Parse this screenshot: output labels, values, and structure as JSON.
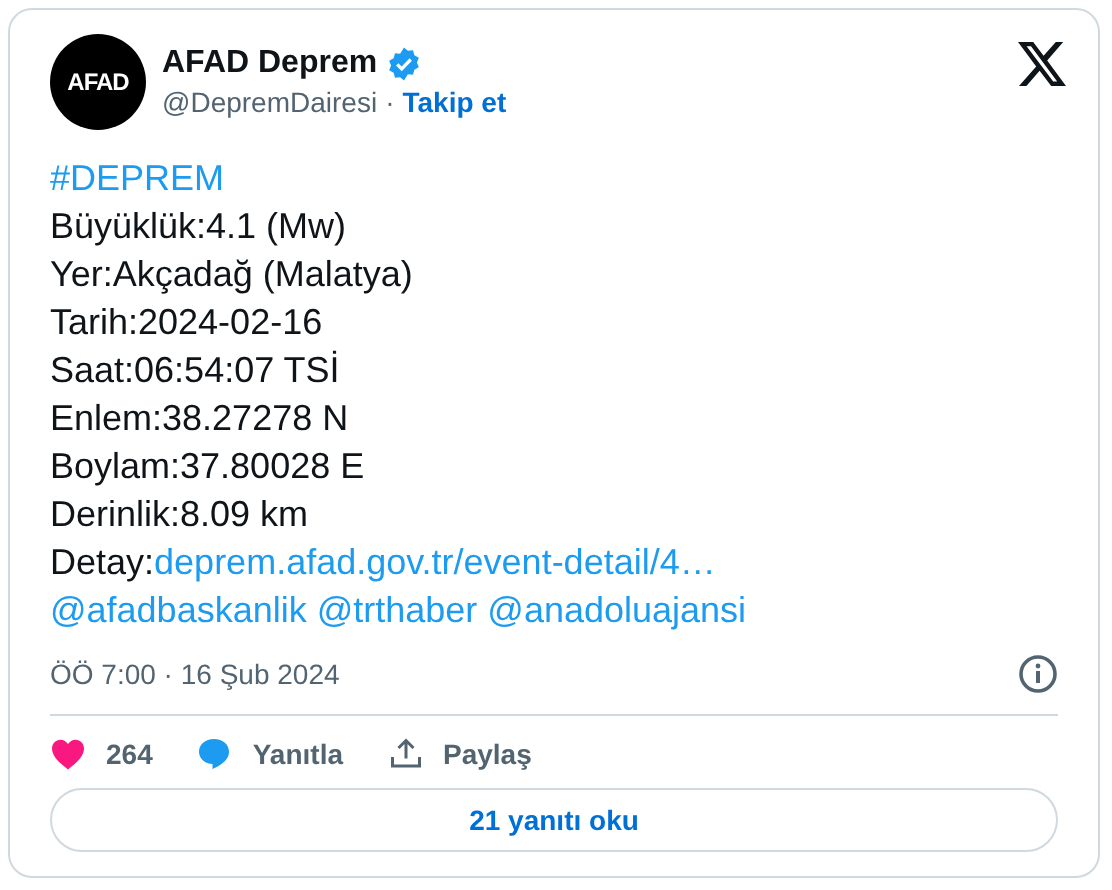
{
  "author": {
    "avatar_text": "AFAD",
    "name": "AFAD Deprem",
    "verified": true,
    "handle": "@DepremDairesi",
    "separator": "·",
    "follow": "Takip et"
  },
  "lines": [
    {
      "parts": [
        {
          "text": "#DEPREM",
          "link": true
        }
      ]
    },
    {
      "parts": [
        {
          "text": "Büyüklük:4.1 (Mw)",
          "link": false
        }
      ]
    },
    {
      "parts": [
        {
          "text": "Yer:Akçadağ (Malatya)",
          "link": false
        }
      ]
    },
    {
      "parts": [
        {
          "text": "Tarih:2024-02-16",
          "link": false
        }
      ]
    },
    {
      "parts": [
        {
          "text": "Saat:06:54:07 TSİ",
          "link": false
        }
      ]
    },
    {
      "parts": [
        {
          "text": "Enlem:38.27278 N",
          "link": false
        }
      ]
    },
    {
      "parts": [
        {
          "text": "Boylam:37.80028 E",
          "link": false
        }
      ]
    },
    {
      "parts": [
        {
          "text": "Derinlik:8.09 km",
          "link": false
        }
      ]
    },
    {
      "parts": [
        {
          "text": "Detay:",
          "link": false
        },
        {
          "text": "deprem.afad.gov.tr/event-detail/4…",
          "link": true
        }
      ]
    },
    {
      "parts": [
        {
          "text": "@afadbaskanlik",
          "link": true
        },
        {
          "text": "@trthaber",
          "link": true
        },
        {
          "text": "@anadoluajansi",
          "link": true
        }
      ]
    }
  ],
  "timestamp": "ÖÖ 7:00 · 16 Şub 2024",
  "actions": [
    {
      "kind": "like",
      "label": "264"
    },
    {
      "kind": "reply",
      "label": "Yanıtla"
    },
    {
      "kind": "share",
      "label": "Paylaş"
    }
  ],
  "read_replies": "21 yanıtı oku"
}
